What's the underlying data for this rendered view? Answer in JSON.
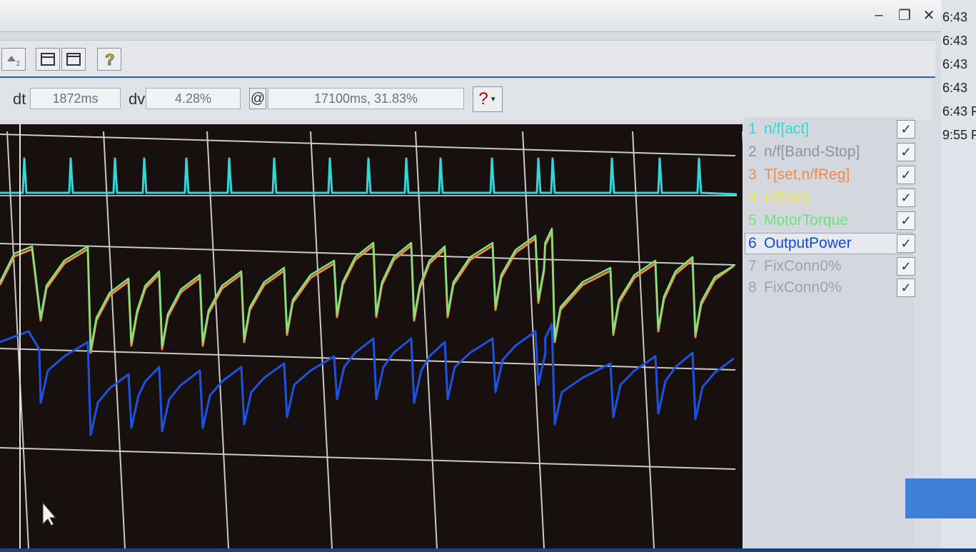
{
  "toolbar": {
    "dt_label": "dt",
    "dt_value": "1872ms",
    "dv_label": "dv",
    "dv_value": "4.28%",
    "at_label": "@",
    "at_value": "17100ms, 31.83%",
    "help_label": "?"
  },
  "window_buttons": {
    "minimize": "–",
    "restore": "❐",
    "close": "✕"
  },
  "legend": {
    "items": [
      {
        "num": "1",
        "label": "n/f[act]",
        "color": "#2fd8d3",
        "checked": true
      },
      {
        "num": "2",
        "label": "n/f[Band-Stop]",
        "color": "#8f949a",
        "checked": true
      },
      {
        "num": "3",
        "label": "T[set,n/fReg]",
        "color": "#ee8a4b",
        "checked": true
      },
      {
        "num": "4",
        "label": "n/f[set]",
        "color": "#e8e35a",
        "checked": true
      },
      {
        "num": "5",
        "label": "MotorTorque",
        "color": "#6fe27b",
        "checked": true
      },
      {
        "num": "6",
        "label": "OutputPower",
        "color": "#1747d4",
        "checked": true
      },
      {
        "num": "7",
        "label": "FixConn0%",
        "color": "#9fa3a8",
        "checked": true
      },
      {
        "num": "8",
        "label": "FixConn0%",
        "color": "#9fa3a8",
        "checked": true
      }
    ]
  },
  "taskbar_times": [
    "6:43",
    "6:43",
    "6:43",
    "6:43",
    "6:43 F",
    "9:55 F"
  ],
  "colors": {
    "plot_bg": "#17100e",
    "grid": "#c9c9c9",
    "cyan": "#31d7d6",
    "orange": "#f08a3f",
    "green": "#7be67f",
    "blue": "#1c52e0"
  }
}
